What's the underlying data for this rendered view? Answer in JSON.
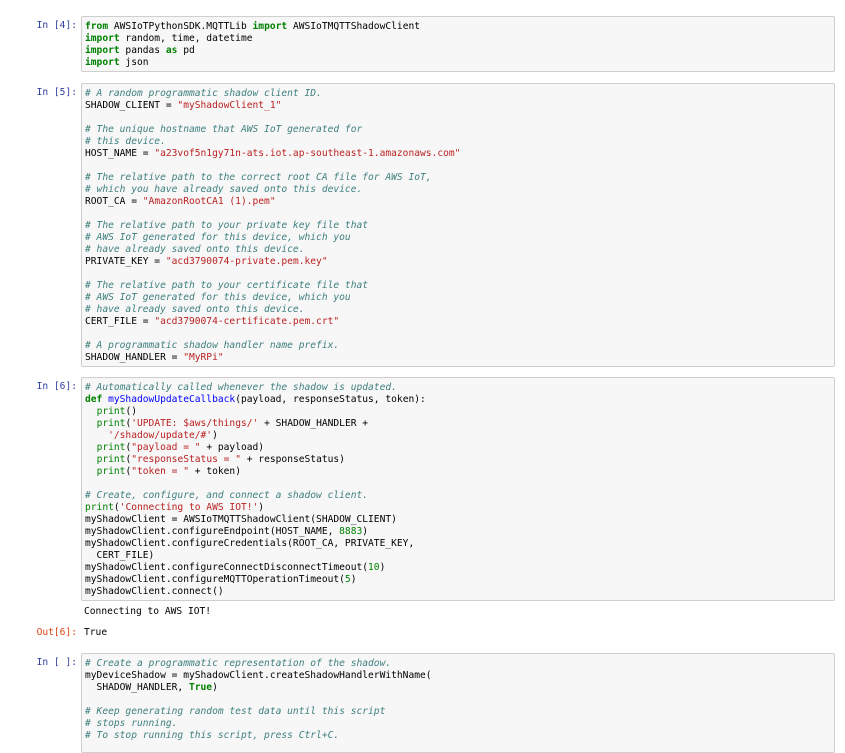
{
  "cells": [
    {
      "prompt": "In [4]:",
      "lines": [
        [
          [
            "k",
            "from"
          ],
          [
            "t",
            " AWSIoTPythonSDK.MQTTLib "
          ],
          [
            "k",
            "import"
          ],
          [
            "t",
            " AWSIoTMQTTShadowClient"
          ]
        ],
        [
          [
            "k",
            "import"
          ],
          [
            "t",
            " random, time, datetime"
          ]
        ],
        [
          [
            "k",
            "import"
          ],
          [
            "t",
            " pandas "
          ],
          [
            "k",
            "as"
          ],
          [
            "t",
            " pd"
          ]
        ],
        [
          [
            "k",
            "import"
          ],
          [
            "t",
            " json"
          ]
        ]
      ]
    },
    {
      "prompt": "In [5]:",
      "lines": [
        [
          [
            "c",
            "# A random programmatic shadow client ID."
          ]
        ],
        [
          [
            "t",
            "SHADOW_CLIENT = "
          ],
          [
            "s",
            "\"myShadowClient_1\""
          ]
        ],
        [],
        [
          [
            "c",
            "# The unique hostname that AWS IoT generated for"
          ]
        ],
        [
          [
            "c",
            "# this device."
          ]
        ],
        [
          [
            "t",
            "HOST_NAME = "
          ],
          [
            "s",
            "\"a23vof5n1gy71n-ats.iot.ap-southeast-1.amazonaws.com\""
          ]
        ],
        [],
        [
          [
            "c",
            "# The relative path to the correct root CA file for AWS IoT,"
          ]
        ],
        [
          [
            "c",
            "# which you have already saved onto this device."
          ]
        ],
        [
          [
            "t",
            "ROOT_CA = "
          ],
          [
            "s",
            "\"AmazonRootCA1 (1).pem\""
          ]
        ],
        [],
        [
          [
            "c",
            "# The relative path to your private key file that"
          ]
        ],
        [
          [
            "c",
            "# AWS IoT generated for this device, which you"
          ]
        ],
        [
          [
            "c",
            "# have already saved onto this device."
          ]
        ],
        [
          [
            "t",
            "PRIVATE_KEY = "
          ],
          [
            "s",
            "\"acd3790074-private.pem.key\""
          ]
        ],
        [],
        [
          [
            "c",
            "# The relative path to your certificate file that"
          ]
        ],
        [
          [
            "c",
            "# AWS IoT generated for this device, which you"
          ]
        ],
        [
          [
            "c",
            "# have already saved onto this device."
          ]
        ],
        [
          [
            "t",
            "CERT_FILE = "
          ],
          [
            "s",
            "\"acd3790074-certificate.pem.crt\""
          ]
        ],
        [],
        [
          [
            "c",
            "# A programmatic shadow handler name prefix."
          ]
        ],
        [
          [
            "t",
            "SHADOW_HANDLER = "
          ],
          [
            "s",
            "\"MyRPi\""
          ]
        ]
      ]
    },
    {
      "prompt": "In [6]:",
      "lines": [
        [
          [
            "c",
            "# Automatically called whenever the shadow is updated."
          ]
        ],
        [
          [
            "k",
            "def"
          ],
          [
            "t",
            " "
          ],
          [
            "f",
            "myShadowUpdateCallback"
          ],
          [
            "t",
            "(payload, responseStatus, token):"
          ]
        ],
        [
          [
            "t",
            "  "
          ],
          [
            "kb",
            "print"
          ],
          [
            "t",
            "()"
          ]
        ],
        [
          [
            "t",
            "  "
          ],
          [
            "kb",
            "print"
          ],
          [
            "t",
            "("
          ],
          [
            "s",
            "'UPDATE: $aws/things/'"
          ],
          [
            "t",
            " + SHADOW_HANDLER +"
          ]
        ],
        [
          [
            "t",
            "    "
          ],
          [
            "s",
            "'/shadow/update/#'"
          ],
          [
            "t",
            ")"
          ]
        ],
        [
          [
            "t",
            "  "
          ],
          [
            "kb",
            "print"
          ],
          [
            "t",
            "("
          ],
          [
            "s",
            "\"payload = \""
          ],
          [
            "t",
            " + payload)"
          ]
        ],
        [
          [
            "t",
            "  "
          ],
          [
            "kb",
            "print"
          ],
          [
            "t",
            "("
          ],
          [
            "s",
            "\"responseStatus = \""
          ],
          [
            "t",
            " + responseStatus)"
          ]
        ],
        [
          [
            "t",
            "  "
          ],
          [
            "kb",
            "print"
          ],
          [
            "t",
            "("
          ],
          [
            "s",
            "\"token = \""
          ],
          [
            "t",
            " + token)"
          ]
        ],
        [],
        [
          [
            "c",
            "# Create, configure, and connect a shadow client."
          ]
        ],
        [
          [
            "kb",
            "print"
          ],
          [
            "t",
            "("
          ],
          [
            "s",
            "'Connecting to AWS IOT!'"
          ],
          [
            "t",
            ")"
          ]
        ],
        [
          [
            "t",
            "myShadowClient = AWSIoTMQTTShadowClient(SHADOW_CLIENT)"
          ]
        ],
        [
          [
            "t",
            "myShadowClient.configureEndpoint(HOST_NAME, "
          ],
          [
            "num",
            "8883"
          ],
          [
            "t",
            ")"
          ]
        ],
        [
          [
            "t",
            "myShadowClient.configureCredentials(ROOT_CA, PRIVATE_KEY,"
          ]
        ],
        [
          [
            "t",
            "  CERT_FILE)"
          ]
        ],
        [
          [
            "t",
            "myShadowClient.configureConnectDisconnectTimeout("
          ],
          [
            "num",
            "10"
          ],
          [
            "t",
            ")"
          ]
        ],
        [
          [
            "t",
            "myShadowClient.configureMQTTOperationTimeout("
          ],
          [
            "num",
            "5"
          ],
          [
            "t",
            ")"
          ]
        ],
        [
          [
            "t",
            "myShadowClient.connect()"
          ]
        ]
      ],
      "stdout": "Connecting to AWS IOT!",
      "out_prompt": "Out[6]:",
      "out_value": "True"
    },
    {
      "prompt": "In [ ]:",
      "lines": [
        [
          [
            "c",
            "# Create a programmatic representation of the shadow."
          ]
        ],
        [
          [
            "t",
            "myDeviceShadow = myShadowClient.createShadowHandlerWithName("
          ]
        ],
        [
          [
            "t",
            "  SHADOW_HANDLER, "
          ],
          [
            "k",
            "True"
          ],
          [
            "t",
            ")"
          ]
        ],
        [],
        [
          [
            "c",
            "# Keep generating random test data until this script"
          ]
        ],
        [
          [
            "c",
            "# stops running."
          ]
        ],
        [
          [
            "c",
            "# To stop running this script, press Ctrl+C."
          ]
        ]
      ]
    }
  ]
}
